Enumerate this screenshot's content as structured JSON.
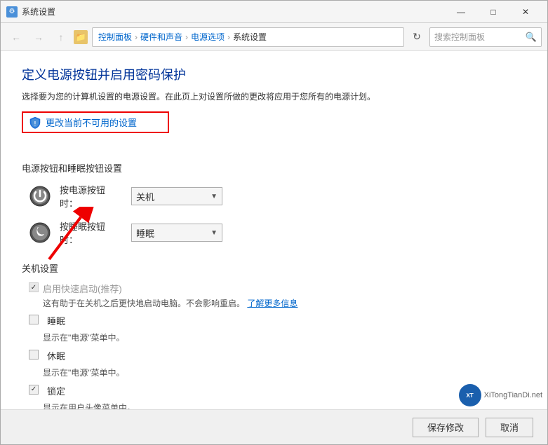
{
  "window": {
    "title": "系统设置",
    "icon": "⚙"
  },
  "titlebar": {
    "minimize": "—",
    "maximize": "□",
    "close": "✕"
  },
  "addressbar": {
    "back": "←",
    "forward": "→",
    "up": "↑",
    "breadcrumbs": [
      "控制面板",
      "硬件和声音",
      "电源选项",
      "系统设置"
    ],
    "refresh": "↻",
    "search_placeholder": "搜索控制面板"
  },
  "page": {
    "title": "定义电源按钮并启用密码保护",
    "subtitle": "选择要为您的计算机设置的电源设置。在此页上对设置所做的更改将应用于您所有的电源计划。",
    "change_settings_btn": "更改当前不可用的设置",
    "power_button_section": "电源按钮和睡眠按钮设置",
    "power_button_label": "按电源按钮时：",
    "power_button_value": "关机",
    "sleep_button_label": "按睡眠按钮时：",
    "sleep_button_value": "睡眠",
    "shutdown_section": "关机设置",
    "fast_startup_label": "启用快速启动(推荐)",
    "fast_startup_desc1": "这有助于在关机之后更快地启动电脑。不会影响重启。",
    "fast_startup_link": "了解更多信息",
    "sleep_label": "睡眠",
    "sleep_desc": "显示在\"电源\"菜单中。",
    "hibernate_label": "休眠",
    "hibernate_desc": "显示在\"电源\"菜单中。",
    "lock_label": "锁定",
    "lock_desc": "显示在用户头像菜单中。"
  },
  "bottom": {
    "save_btn": "保存修改",
    "cancel_btn": "取消"
  },
  "watermark": {
    "site": "XiTongTianDi.net",
    "logo_text": "XT"
  }
}
